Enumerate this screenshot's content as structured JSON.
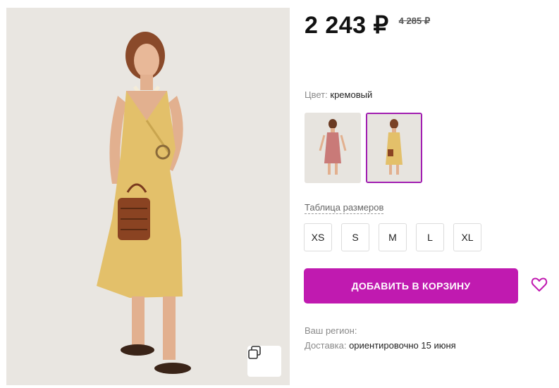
{
  "product": {
    "price_current": "2 243 ₽",
    "price_old": "4 285 ₽",
    "color_label": "Цвет:",
    "color_value": "кремовый"
  },
  "swatches": [
    {
      "name": "pink dress",
      "selected": false,
      "color": "#c97a78"
    },
    {
      "name": "yellow dress",
      "selected": true,
      "color": "#e3c06a"
    }
  ],
  "size_table_label": "Таблица размеров",
  "sizes": [
    "XS",
    "S",
    "M",
    "L",
    "XL"
  ],
  "add_to_cart_label": "ДОБАВИТЬ В КОРЗИНУ",
  "region_label": "Ваш регион:",
  "delivery": {
    "label": "Доставка:",
    "value": "ориентировочно 15 июня"
  },
  "colors": {
    "accent": "#c01ab0",
    "selected_border": "#a11eb1"
  },
  "icons": {
    "zoom": "copy-zoom-icon",
    "favorite": "heart-icon"
  }
}
